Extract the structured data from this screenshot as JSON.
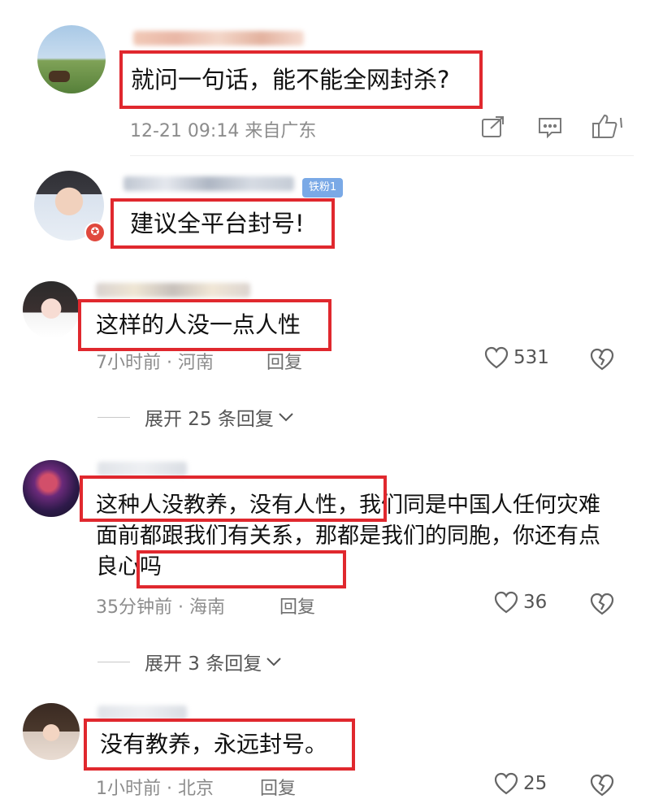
{
  "comments": [
    {
      "text": "就问一句话，能不能全网封杀?",
      "meta": "12-21 09:14 来自广东"
    },
    {
      "text": "建议全平台封号!",
      "badge": "铁粉1"
    },
    {
      "text": "这样的人没一点人性",
      "meta": "7小时前 · 河南",
      "reply": "回复",
      "likes": "531",
      "expand": "展开 25 条回复"
    },
    {
      "text_part1": "这种人没教养，没有人性",
      "text_part2": "，我们同是中国人任何灾难面前都跟我们有关系，那都是我们的同胞，",
      "text_part3": "你还有点良心吗",
      "meta": "35分钟前 · 海南",
      "reply": "回复",
      "likes": "36",
      "expand": "展开 3 条回复"
    },
    {
      "text": "没有教养，永远封号。",
      "meta": "1小时前 · 北京",
      "reply": "回复",
      "likes": "25"
    }
  ],
  "colors": {
    "highlight": "#e0282e",
    "meta": "#8c8c8c"
  }
}
